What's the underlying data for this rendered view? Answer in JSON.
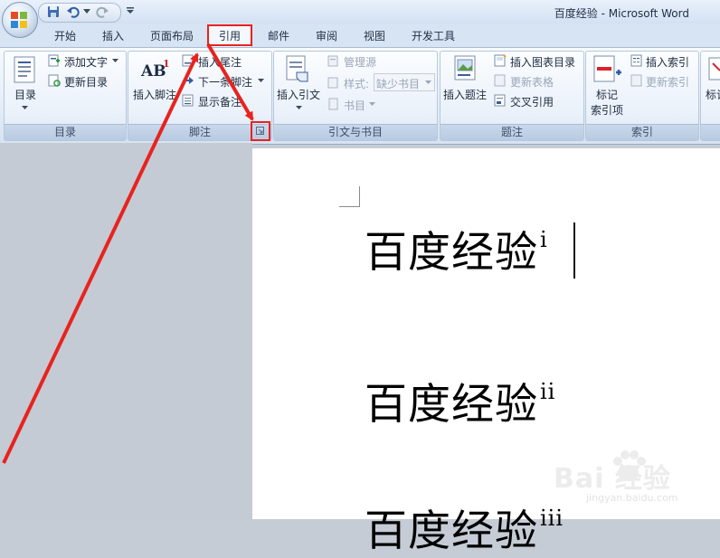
{
  "window": {
    "title": "百度经验 - Microsoft Word"
  },
  "tabs": [
    {
      "label": "开始"
    },
    {
      "label": "插入"
    },
    {
      "label": "页面布局"
    },
    {
      "label": "引用",
      "active": true
    },
    {
      "label": "邮件"
    },
    {
      "label": "审阅"
    },
    {
      "label": "视图"
    },
    {
      "label": "开发工具"
    }
  ],
  "ribbon": {
    "toc": {
      "group": "目录",
      "big": "目录",
      "add_text": "添加文字",
      "update": "更新目录"
    },
    "footnotes": {
      "group": "脚注",
      "big": "插入脚注",
      "endnote": "插入尾注",
      "next": "下一条脚注",
      "show": "显示备注"
    },
    "citations": {
      "group": "引文与书目",
      "big": "插入引文",
      "manage": "管理源",
      "style_label": "样式:",
      "style_value": "缺少书目",
      "bibliography": "书目"
    },
    "captions": {
      "group": "题注",
      "big": "插入题注",
      "insert_tof": "插入图表目录",
      "update_table": "更新表格",
      "crossref": "交叉引用"
    },
    "index": {
      "group": "索引",
      "big1": "标记",
      "big2": "索引项",
      "insert": "插入索引",
      "update": "更新索引"
    },
    "toa": {
      "big": "标记"
    }
  },
  "document": {
    "lines": [
      {
        "text": "百度经验",
        "note": "i"
      },
      {
        "text": "百度经验",
        "note": "ii"
      },
      {
        "text": "百度经验",
        "note": "iii"
      }
    ]
  },
  "watermark": {
    "brand": "Bai  经验",
    "url": "jingyan.baidu.com"
  },
  "annotations": {
    "color": "#e8231e"
  },
  "colors": {
    "ribbon": "#e4edf8",
    "tabs": "#d7e4f3",
    "page": "#ffffff"
  }
}
